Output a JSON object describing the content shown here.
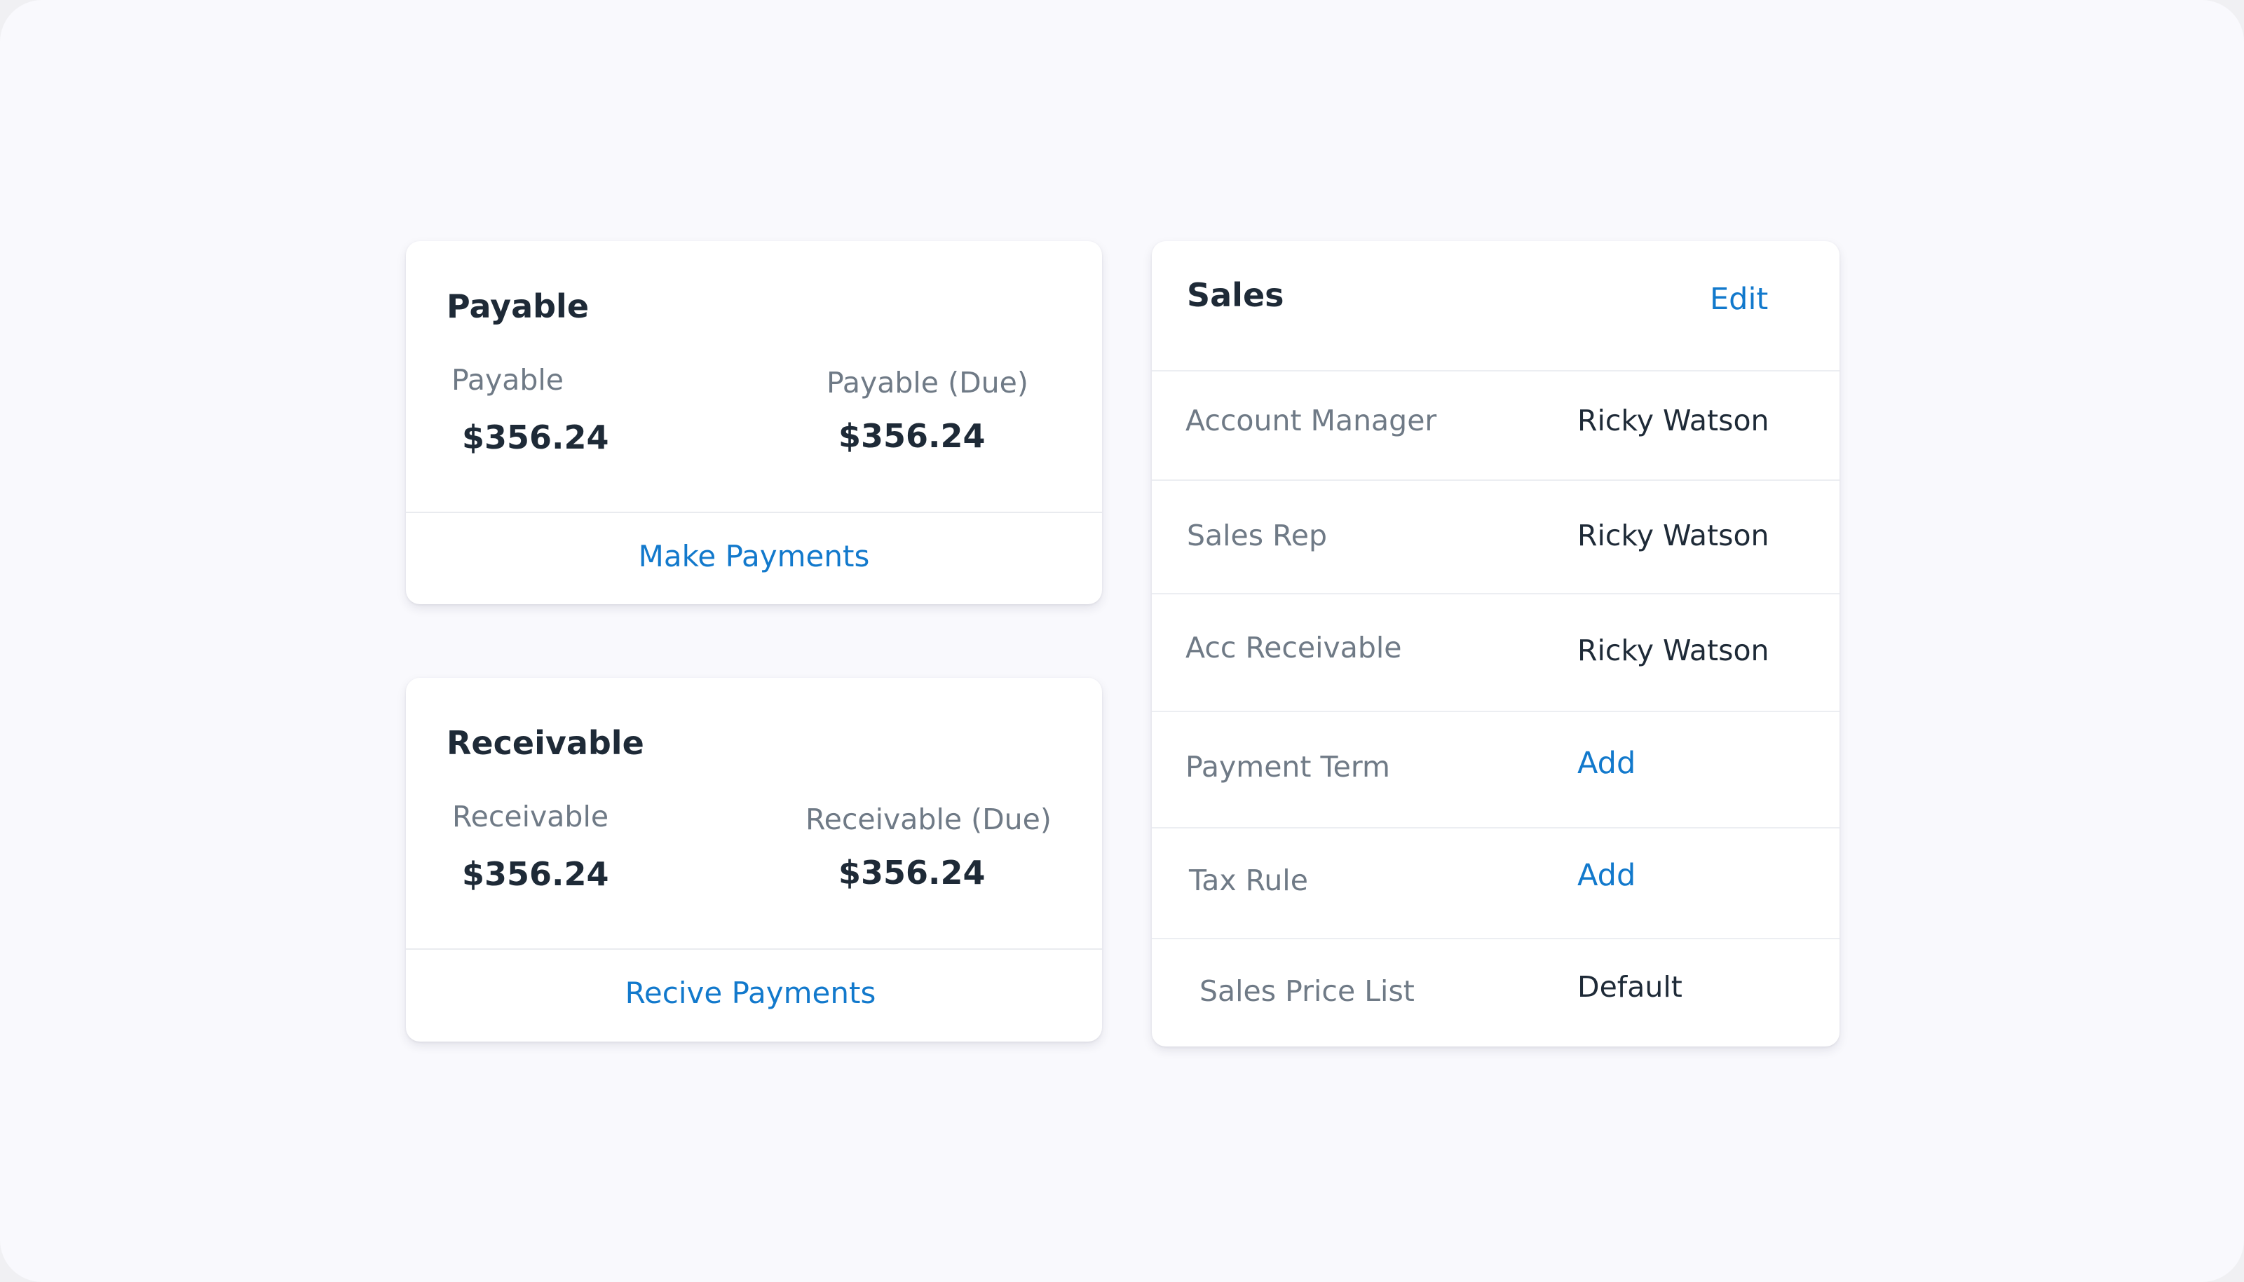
{
  "payable": {
    "title": "Payable",
    "label": "Payable",
    "amount": "$356.24",
    "due_label": "Payable (Due)",
    "due_amount": "$356.24",
    "action": "Make Payments"
  },
  "receivable": {
    "title": "Receivable",
    "label": "Receivable",
    "amount": "$356.24",
    "due_label": "Receivable (Due)",
    "due_amount": "$356.24",
    "action": "Recive Payments"
  },
  "sales": {
    "title": "Sales",
    "edit_label": "Edit",
    "rows": [
      {
        "label": "Account Manager",
        "value": "Ricky Watson"
      },
      {
        "label": "Sales Rep",
        "value": "Ricky Watson"
      },
      {
        "label": "Acc Receivable",
        "value": "Ricky Watson"
      },
      {
        "label": "Payment Term",
        "value": "Add"
      },
      {
        "label": "Tax Rule",
        "value": "Add"
      },
      {
        "label": "Sales Price List",
        "value": "Default"
      }
    ]
  },
  "colors": {
    "background": "#f9f9fd",
    "card": "#ffffff",
    "text_primary": "#1e2a37",
    "text_secondary": "#6f7a86",
    "link": "#1279cc",
    "divider": "#e9ebef"
  }
}
